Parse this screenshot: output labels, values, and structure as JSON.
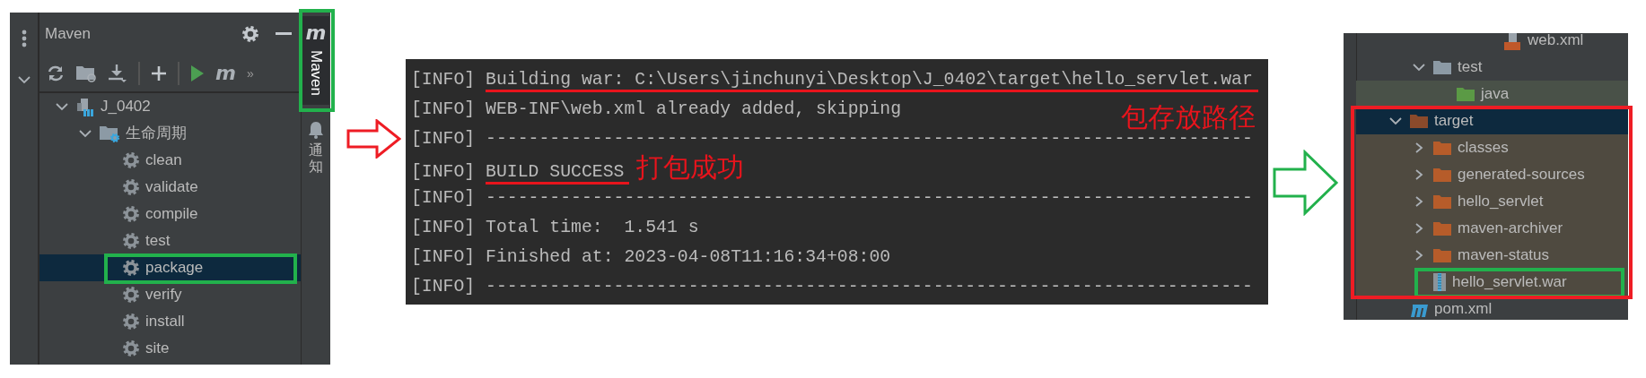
{
  "maven_panel": {
    "title": "Maven",
    "toolbar": [
      {
        "kind": "refresh"
      },
      {
        "kind": "folder_sync"
      },
      {
        "kind": "download"
      },
      {
        "kind": "separator"
      },
      {
        "kind": "add"
      },
      {
        "kind": "separator"
      },
      {
        "kind": "run"
      },
      {
        "kind": "maven",
        "text": "m"
      },
      {
        "kind": "more",
        "text": "»"
      }
    ],
    "tree": [
      {
        "label": "J_0402",
        "kind": "project",
        "expanded": true,
        "selected": false,
        "children": [
          {
            "label": "生命周期",
            "kind": "lifecycle",
            "expanded": true,
            "selected": false,
            "children": [
              {
                "label": "clean",
                "kind": "goal",
                "selected": false
              },
              {
                "label": "validate",
                "kind": "goal",
                "selected": false
              },
              {
                "label": "compile",
                "kind": "goal",
                "selected": false
              },
              {
                "label": "test",
                "kind": "goal",
                "selected": false
              },
              {
                "label": "package",
                "kind": "goal",
                "selected": true,
                "color": "#22b14c"
              },
              {
                "label": "verify",
                "kind": "goal",
                "selected": false
              },
              {
                "label": "install",
                "kind": "goal",
                "selected": false
              },
              {
                "label": "site",
                "kind": "goal",
                "selected": false
              }
            ]
          }
        ]
      }
    ],
    "side_tabs": [
      {
        "label": "Maven",
        "logo": "m",
        "selected": true,
        "color": "#22b14c"
      },
      {
        "label": "通知",
        "selected": false
      }
    ]
  },
  "console": {
    "lines": [
      {
        "prefix": "[INFO]",
        "text": "Building war: C:\\Users\\jinchunyi\\Desktop\\J_0402\\target\\hello_servlet.war",
        "underlined": true
      },
      {
        "prefix": "[INFO]",
        "text": "WEB-INF\\web.xml already added, skipping",
        "underlined": false,
        "note": "包存放路径",
        "note_at_end": true
      },
      {
        "prefix": "[INFO]",
        "text": "------------------------------------------------------------------------",
        "underlined": false
      },
      {
        "prefix": "[INFO]",
        "text": "BUILD SUCCESS",
        "underlined": true,
        "note": "打包成功",
        "note_at_end": false
      },
      {
        "prefix": "[INFO]",
        "text": "------------------------------------------------------------------------",
        "underlined": false
      },
      {
        "prefix": "[INFO]",
        "text": "Total time:  1.541 s",
        "underlined": false
      },
      {
        "prefix": "[INFO]",
        "text": "Finished at: 2023-04-08T11:16:34+08:00",
        "underlined": false
      },
      {
        "prefix": "[INFO]",
        "text": "------------------------------------------------------------------------",
        "underlined": false
      }
    ]
  },
  "project_tree": {
    "tree": [
      {
        "children": [
          {
            "children": [
              {
                "children": [
                  {
                    "children": [
                      {
                        "label": "web.xml",
                        "kind": "xml_file",
                        "selected": false
                      }
                    ]
                  }
                ]
              }
            ]
          },
          {
            "label": "test",
            "kind": "folder",
            "expanded": true,
            "selected": false,
            "children": [
              {
                "label": "java",
                "kind": "test_source_folder",
                "selected": false
              }
            ]
          }
        ]
      },
      {
        "label": "target",
        "kind": "excluded_folder",
        "expanded": true,
        "selected": true,
        "color": "#ee1c24",
        "children": [
          {
            "label": "classes",
            "kind": "folder",
            "expanded": false,
            "selected": false
          },
          {
            "label": "generated-sources",
            "kind": "folder",
            "expanded": false,
            "selected": false
          },
          {
            "label": "hello_servlet",
            "kind": "folder",
            "expanded": false,
            "selected": false
          },
          {
            "label": "maven-archiver",
            "kind": "folder",
            "expanded": false,
            "selected": false
          },
          {
            "label": "maven-status",
            "kind": "folder",
            "expanded": false,
            "selected": false
          },
          {
            "label": "hello_servlet.war",
            "kind": "war_file",
            "selected": false,
            "color": "#22b14c"
          }
        ]
      },
      {
        "label": "pom.xml",
        "kind": "pom_file",
        "selected": false
      }
    ]
  }
}
